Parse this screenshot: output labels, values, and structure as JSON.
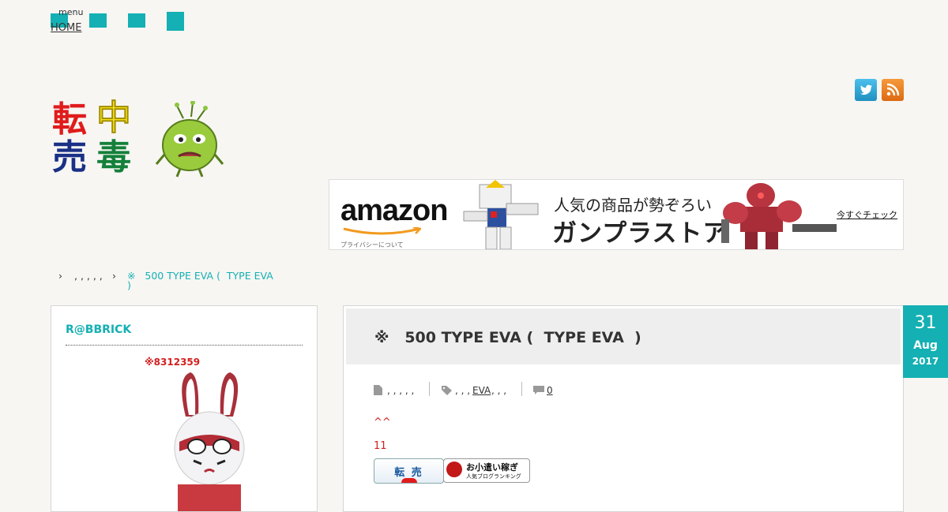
{
  "nav": {
    "menu_label": "menu",
    "home_label": "HOME"
  },
  "header": {
    "logo_chars": [
      "転",
      "中",
      "売",
      "毒"
    ]
  },
  "ad": {
    "brand": "amazon",
    "privacy": "プライバシーについて",
    "line1": "人気の商品が勢ぞろい",
    "line2": "ガンプラストア",
    "cta": "今すぐチェック"
  },
  "breadcrumb": {
    "sep1": "›",
    "item1": ", , , , ,",
    "sep2": "›",
    "current_line1": "※   500 TYPE EVA (  TYPE EVA",
    "current_line2": ")"
  },
  "sidebar": {
    "title": "R@BBRICK",
    "code": "※8312359"
  },
  "post": {
    "title": "※   500 TYPE EVA (  TYPE EVA  )",
    "date": {
      "day": "31",
      "month": "Aug",
      "year": "2017"
    },
    "categories": ", , , , ,",
    "tags_prefix": ", , ,",
    "tag_link": "EVA",
    "tags_suffix": ", , ,",
    "comments": "0",
    "body_line1": "^^",
    "body_line2": "11",
    "rank_btn1": "転 売",
    "rank_btn2_top": "お小遣い稼ぎ",
    "rank_btn2_bottom": "人気ブログランキング"
  },
  "colors": {
    "accent": "#14b0b3",
    "highlight": "#d21f1f",
    "background": "#f7f6f3"
  },
  "icons": [
    "twitter-icon",
    "rss-icon",
    "file-icon",
    "tag-icon",
    "comment-icon"
  ]
}
